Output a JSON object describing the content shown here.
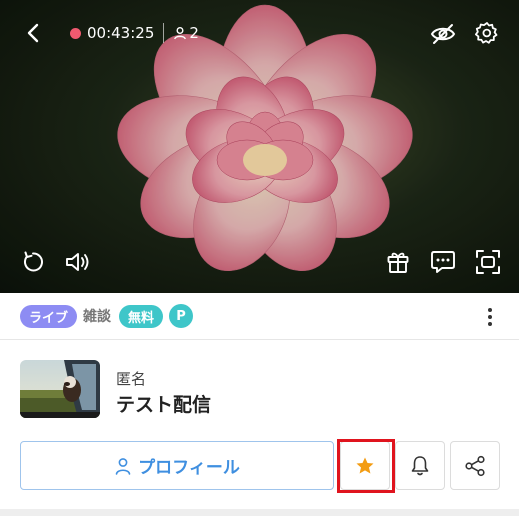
{
  "player": {
    "timer": "00:43:25",
    "viewer_count": "2",
    "colors": {
      "rec_dot": "#ef5a6f"
    },
    "icons": [
      "back-arrow-icon",
      "person-icon",
      "eye-off-icon",
      "gear-icon",
      "replay-icon",
      "volume-icon",
      "gift-icon",
      "comment-icon",
      "screenshot-icon"
    ]
  },
  "tags": {
    "live": "ライブ",
    "category": "雑談",
    "free": "無料",
    "p": "P",
    "colors": {
      "live": "#8d8cf3",
      "free": "#3ec6c9"
    }
  },
  "streamer": {
    "name": "匿名",
    "title": "テスト配信"
  },
  "actions": {
    "profile_label": "プロフィール",
    "icons": [
      "person-icon",
      "star-icon",
      "bell-icon",
      "share-icon"
    ],
    "colors": {
      "profile": "#3f8fe0",
      "star": "#f39c12",
      "highlight": "#e0141e"
    }
  }
}
